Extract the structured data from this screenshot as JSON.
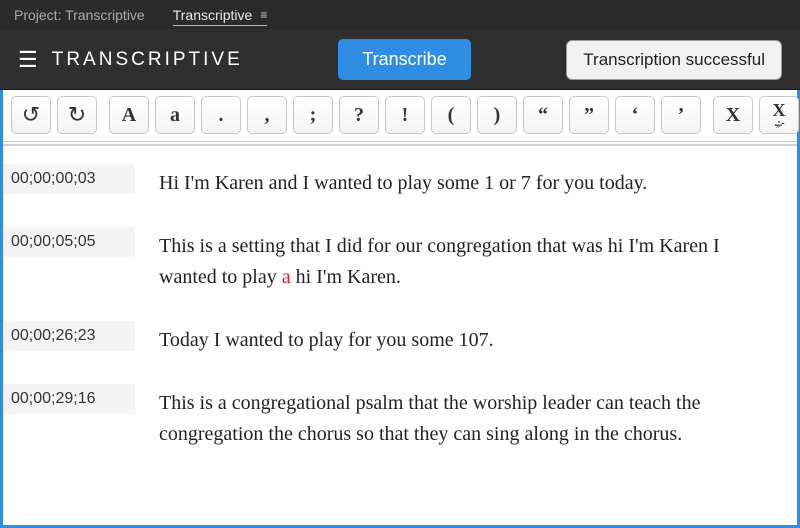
{
  "topbar": {
    "project_label": "Project: Transcriptive",
    "tab_label": "Transcriptive"
  },
  "header": {
    "brand": "TRANSCRIPTIVE",
    "transcribe_label": "Transcribe",
    "status": "Transcription successful"
  },
  "toolbar": {
    "undo": "↺",
    "redo": "↻",
    "upper": "A",
    "lower": "a",
    "period": ".",
    "comma": ",",
    "semicolon": ";",
    "question": "?",
    "exclaim": "!",
    "paren_open": "(",
    "paren_close": ")",
    "dquote_open": "“",
    "dquote_close": "”",
    "squote_open": "‘",
    "squote_close": "’",
    "x": "X",
    "xdots_top": "X",
    "xdots_bot": ".,;.-"
  },
  "rows": [
    {
      "time": "00;00;00;03",
      "text": "Hi I'm Karen and I wanted to play some 1 or 7 for you today."
    },
    {
      "time": "00;00;05;05",
      "text_pre": "This is a setting that I did for our congregation that was hi I'm Karen I wanted to play ",
      "text_low": "a",
      "text_post": " hi I'm Karen."
    },
    {
      "time": "00;00;26;23",
      "text": "Today I wanted to play for you some 107."
    },
    {
      "time": "00;00;29;16",
      "text": "This is a congregational psalm that the worship leader can teach the congregation the chorus so that they can sing along in the chorus."
    }
  ]
}
